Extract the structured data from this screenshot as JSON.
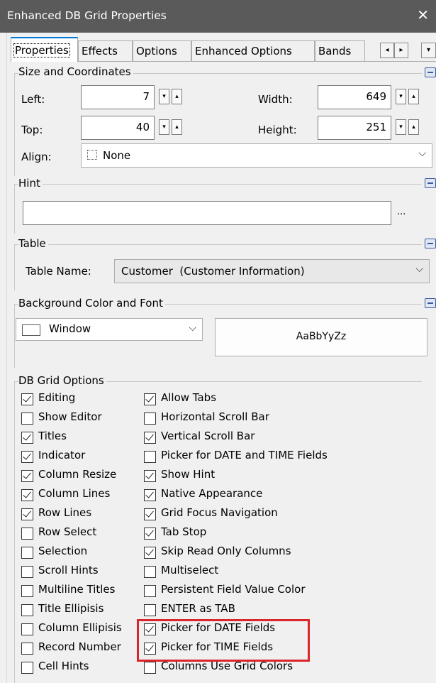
{
  "window": {
    "title": "Enhanced DB Grid Properties",
    "close_glyph": "✕"
  },
  "tabs": [
    "Properties",
    "Effects",
    "Options",
    "Enhanced Options",
    "Bands"
  ],
  "tab_scroll": {
    "left_glyph": "◂",
    "right_glyph": "▸",
    "menu_glyph": "▾"
  },
  "size_coords": {
    "title": "Size and Coordinates",
    "left_label": "Left:",
    "left_value": "7",
    "top_label": "Top:",
    "top_value": "40",
    "width_label": "Width:",
    "width_value": "649",
    "height_label": "Height:",
    "height_value": "251",
    "align_label": "Align:",
    "align_value": "None"
  },
  "hint": {
    "title": "Hint",
    "value": "",
    "ellipsis": "..."
  },
  "table": {
    "title": "Table",
    "name_label": "Table Name:",
    "name_value": "Customer  (Customer Information)"
  },
  "background": {
    "title": "Background Color and Font",
    "color_value": "Window",
    "font_sample": "AaBbYyZz"
  },
  "grid_options": {
    "title": "DB Grid Options",
    "left": [
      {
        "label": "Editing",
        "checked": true
      },
      {
        "label": "Show Editor",
        "checked": false
      },
      {
        "label": "Titles",
        "checked": true
      },
      {
        "label": "Indicator",
        "checked": true
      },
      {
        "label": "Column Resize",
        "checked": true
      },
      {
        "label": "Column Lines",
        "checked": true
      },
      {
        "label": "Row Lines",
        "checked": true
      },
      {
        "label": "Row Select",
        "checked": false
      },
      {
        "label": "Selection",
        "checked": false
      },
      {
        "label": "Scroll Hints",
        "checked": false
      },
      {
        "label": "Multiline Titles",
        "checked": false
      },
      {
        "label": "Title Ellipisis",
        "checked": false
      },
      {
        "label": "Column Ellipisis",
        "checked": false
      },
      {
        "label": "Record Number",
        "checked": false
      },
      {
        "label": "Cell Hints",
        "checked": false
      }
    ],
    "right": [
      {
        "label": "Allow Tabs",
        "checked": true
      },
      {
        "label": "Horizontal Scroll Bar",
        "checked": false
      },
      {
        "label": "Vertical Scroll Bar",
        "checked": true
      },
      {
        "label": "Picker for DATE and TIME Fields",
        "checked": false
      },
      {
        "label": "Show Hint",
        "checked": true
      },
      {
        "label": "Native Appearance",
        "checked": true
      },
      {
        "label": "Grid Focus Navigation",
        "checked": true
      },
      {
        "label": "Tab Stop",
        "checked": true
      },
      {
        "label": "Skip Read Only Columns",
        "checked": true
      },
      {
        "label": "Multiselect",
        "checked": false
      },
      {
        "label": "Persistent Field Value Color",
        "checked": false
      },
      {
        "label": "ENTER as TAB",
        "checked": false
      },
      {
        "label": "Picker for DATE Fields",
        "checked": true
      },
      {
        "label": "Picker for TIME Fields",
        "checked": true
      },
      {
        "label": "Columns Use Grid Colors",
        "checked": false
      }
    ]
  },
  "colors": {
    "titlebar": "#5a5a5a",
    "highlight": "#d9262b",
    "tab_accent": "#0078d7"
  }
}
